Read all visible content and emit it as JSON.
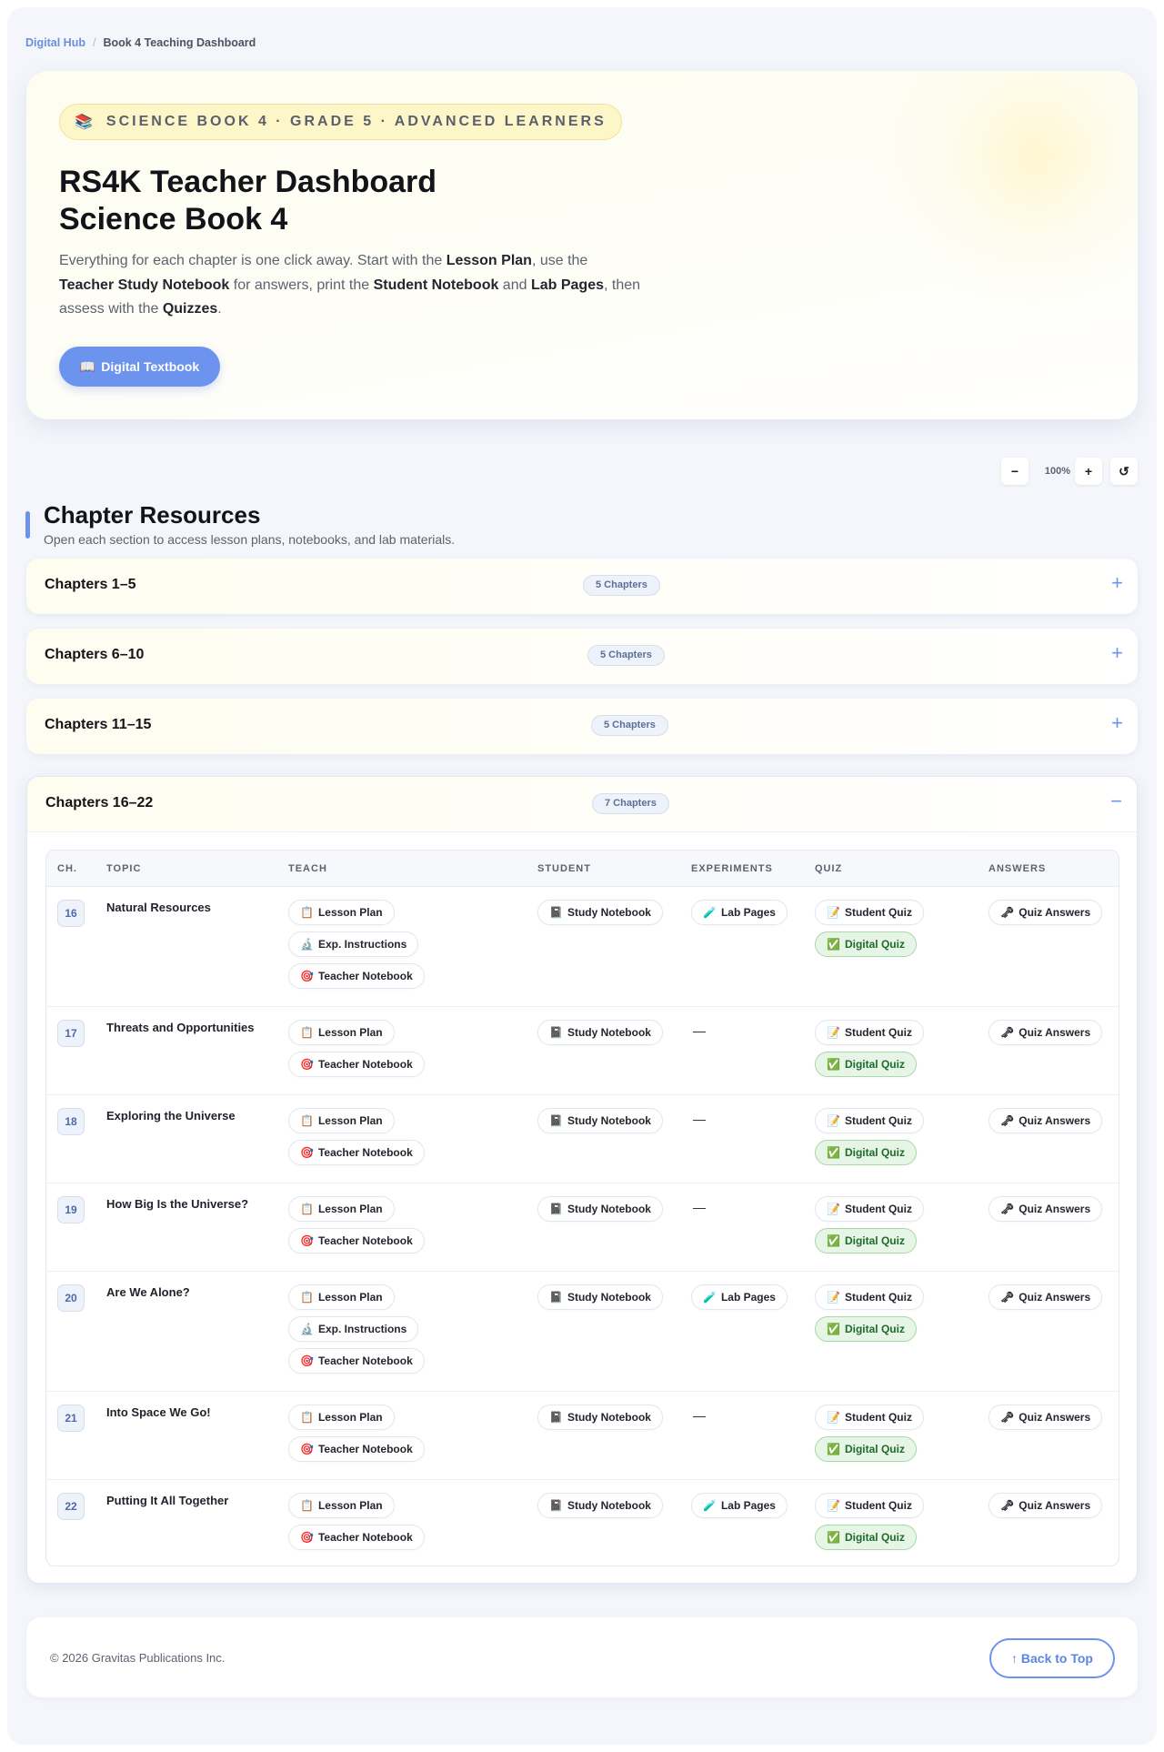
{
  "breadcrumb": {
    "root": "Digital Hub",
    "separator": "/",
    "current": "Book 4 Teaching Dashboard"
  },
  "hero": {
    "badge_icon": "📚",
    "badge_text": "SCIENCE BOOK 4 · GRADE 5 · ADVANCED LEARNERS",
    "title_line1": "RS4K Teacher Dashboard",
    "title_line2": "Science Book 4",
    "desc": {
      "p1": "Everything for each chapter is one click away. Start with the ",
      "b1": "Lesson Plan",
      "p2": ", use the ",
      "b2": "Teacher Study Notebook",
      "p3": " for answers, print the ",
      "b3": "Student Notebook",
      "p4": " and ",
      "b4": "Lab Pages",
      "p5": ", then assess with the ",
      "b5": "Quizzes",
      "p6": "."
    },
    "button_icon": "📖",
    "button_label": "Digital Textbook"
  },
  "zoom": {
    "minus": "−",
    "level": "100%",
    "plus": "+",
    "reset": "↺"
  },
  "section": {
    "title": "Chapter Resources",
    "subtitle": "Open each section to access lesson plans, notebooks, and lab materials."
  },
  "accordions": [
    {
      "title": "Chapters 1–5",
      "chip": "5 Chapters",
      "toggle": "+"
    },
    {
      "title": "Chapters 6–10",
      "chip": "5 Chapters",
      "toggle": "+"
    },
    {
      "title": "Chapters 11–15",
      "chip": "5 Chapters",
      "toggle": "+"
    },
    {
      "title": "Chapters 16–22",
      "chip": "7 Chapters",
      "toggle": "−"
    }
  ],
  "table": {
    "headers": {
      "ch": "CH.",
      "topic": "TOPIC",
      "teach": "TEACH",
      "student": "STUDENT",
      "experiments": "EXPERIMENTS",
      "quiz": "QUIZ",
      "answers": "ANSWERS"
    },
    "labels": {
      "lesson_plan": "Lesson Plan",
      "exp_instructions": "Exp. Instructions",
      "teacher_notebook": "Teacher Notebook",
      "study_notebook": "Study Notebook",
      "lab_pages": "Lab Pages",
      "student_quiz": "Student Quiz",
      "digital_quiz": "Digital Quiz",
      "quiz_answers": "Quiz Answers",
      "none": "—"
    },
    "icons": {
      "lesson_plan": "📋",
      "exp_instructions": "🔬",
      "teacher_notebook": "🎯",
      "study_notebook": "📓",
      "lab_pages": "🧪",
      "student_quiz": "📝",
      "digital_quiz": "✅",
      "quiz_answers": "🗝"
    },
    "rows": [
      {
        "ch": "16",
        "topic": "Natural Resources"
      },
      {
        "ch": "17",
        "topic": "Threats and Opportunities"
      },
      {
        "ch": "18",
        "topic": "Exploring the Universe"
      },
      {
        "ch": "19",
        "topic": "How Big Is the Universe?"
      },
      {
        "ch": "20",
        "topic": "Are We Alone?"
      },
      {
        "ch": "21",
        "topic": "Into Space We Go!"
      },
      {
        "ch": "22",
        "topic": "Putting It All Together"
      }
    ]
  },
  "footer": {
    "copyright": "© 2026 Gravitas Publications Inc.",
    "back_to_top": "↑ Back to Top"
  },
  "colors": {
    "accent": "#6c93ee",
    "badge_bg": "#fdf6c9",
    "green": "#e6f5e6"
  }
}
